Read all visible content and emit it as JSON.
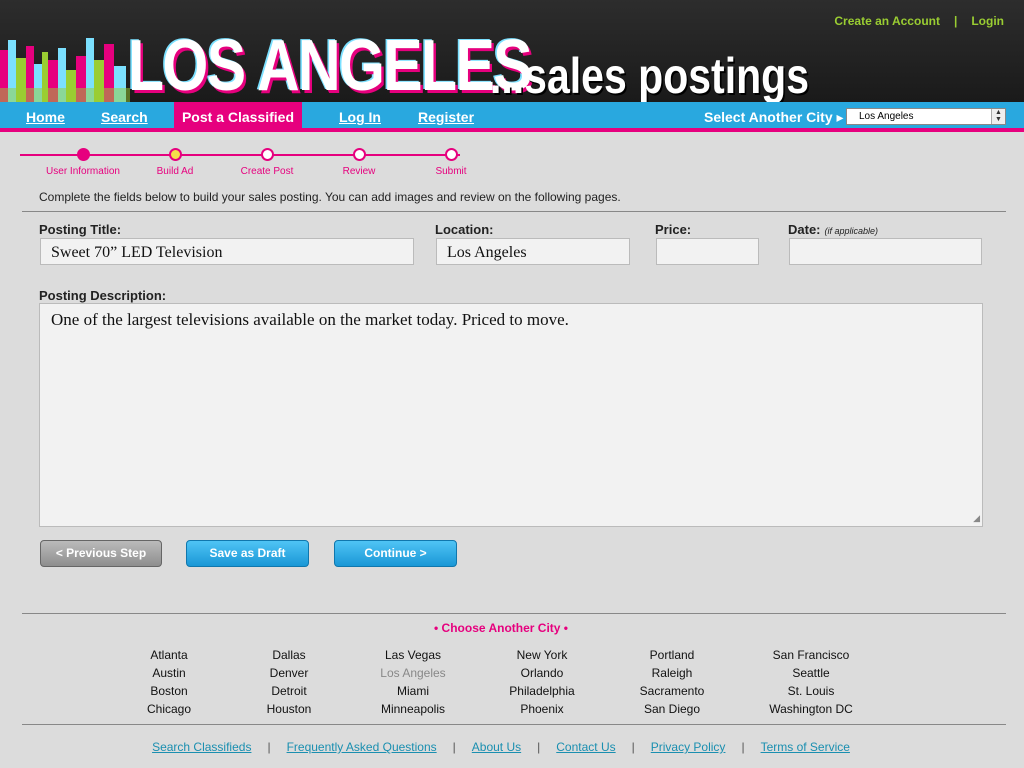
{
  "header": {
    "title": "LOS ANGELES",
    "subtitle": "...sales postings",
    "create_account": "Create an Account",
    "separator": "|",
    "login": "Login"
  },
  "nav": {
    "home": "Home",
    "search": "Search",
    "post": "Post a Classified",
    "login": "Log In",
    "register": "Register",
    "select_city_label": "Select Another City ▸",
    "selected_city": "Los Angeles"
  },
  "progress": {
    "steps": [
      {
        "label": "User Information",
        "state": "complete"
      },
      {
        "label": "Build Ad",
        "state": "current"
      },
      {
        "label": "Create Post",
        "state": "pending"
      },
      {
        "label": "Review",
        "state": "pending"
      },
      {
        "label": "Submit",
        "state": "pending"
      }
    ]
  },
  "form": {
    "instructions": "Complete the fields below to build your sales posting.  You can add images and review on the following pages.",
    "title_label": "Posting Title:",
    "title_value": "Sweet 70” LED Television",
    "location_label": "Location:",
    "location_value": "Los Angeles",
    "price_label": "Price:",
    "price_value": "",
    "date_label": "Date:",
    "date_note": "(if applicable)",
    "date_value": "",
    "description_label": "Posting Description:",
    "description_value": "One of the largest televisions available on the market today.  Priced to move."
  },
  "buttons": {
    "previous": "< Previous Step",
    "save_draft": "Save as Draft",
    "continue": "Continue >"
  },
  "choose_city": "• Choose Another City •",
  "cities": [
    [
      "Atlanta",
      "Austin",
      "Boston",
      "Chicago"
    ],
    [
      "Dallas",
      "Denver",
      "Detroit",
      "Houston"
    ],
    [
      "Las Vegas",
      "Los Angeles",
      "Miami",
      "Minneapolis"
    ],
    [
      "New York",
      "Orlando",
      "Philadelphia",
      "Phoenix"
    ],
    [
      "Portland",
      "Raleigh",
      "Sacramento",
      "San Diego"
    ],
    [
      "San Francisco",
      "Seattle",
      "St. Louis",
      "Washington DC"
    ]
  ],
  "footer": {
    "links": [
      "Search Classifieds",
      "Frequently Asked Questions",
      "About Us",
      "Contact Us",
      "Privacy Policy",
      "Terms of Service"
    ],
    "separator": "|"
  },
  "colors": {
    "accent": "#e6007e",
    "nav": "#29a8df",
    "header": "#222222",
    "top_links": "#9acd32"
  }
}
